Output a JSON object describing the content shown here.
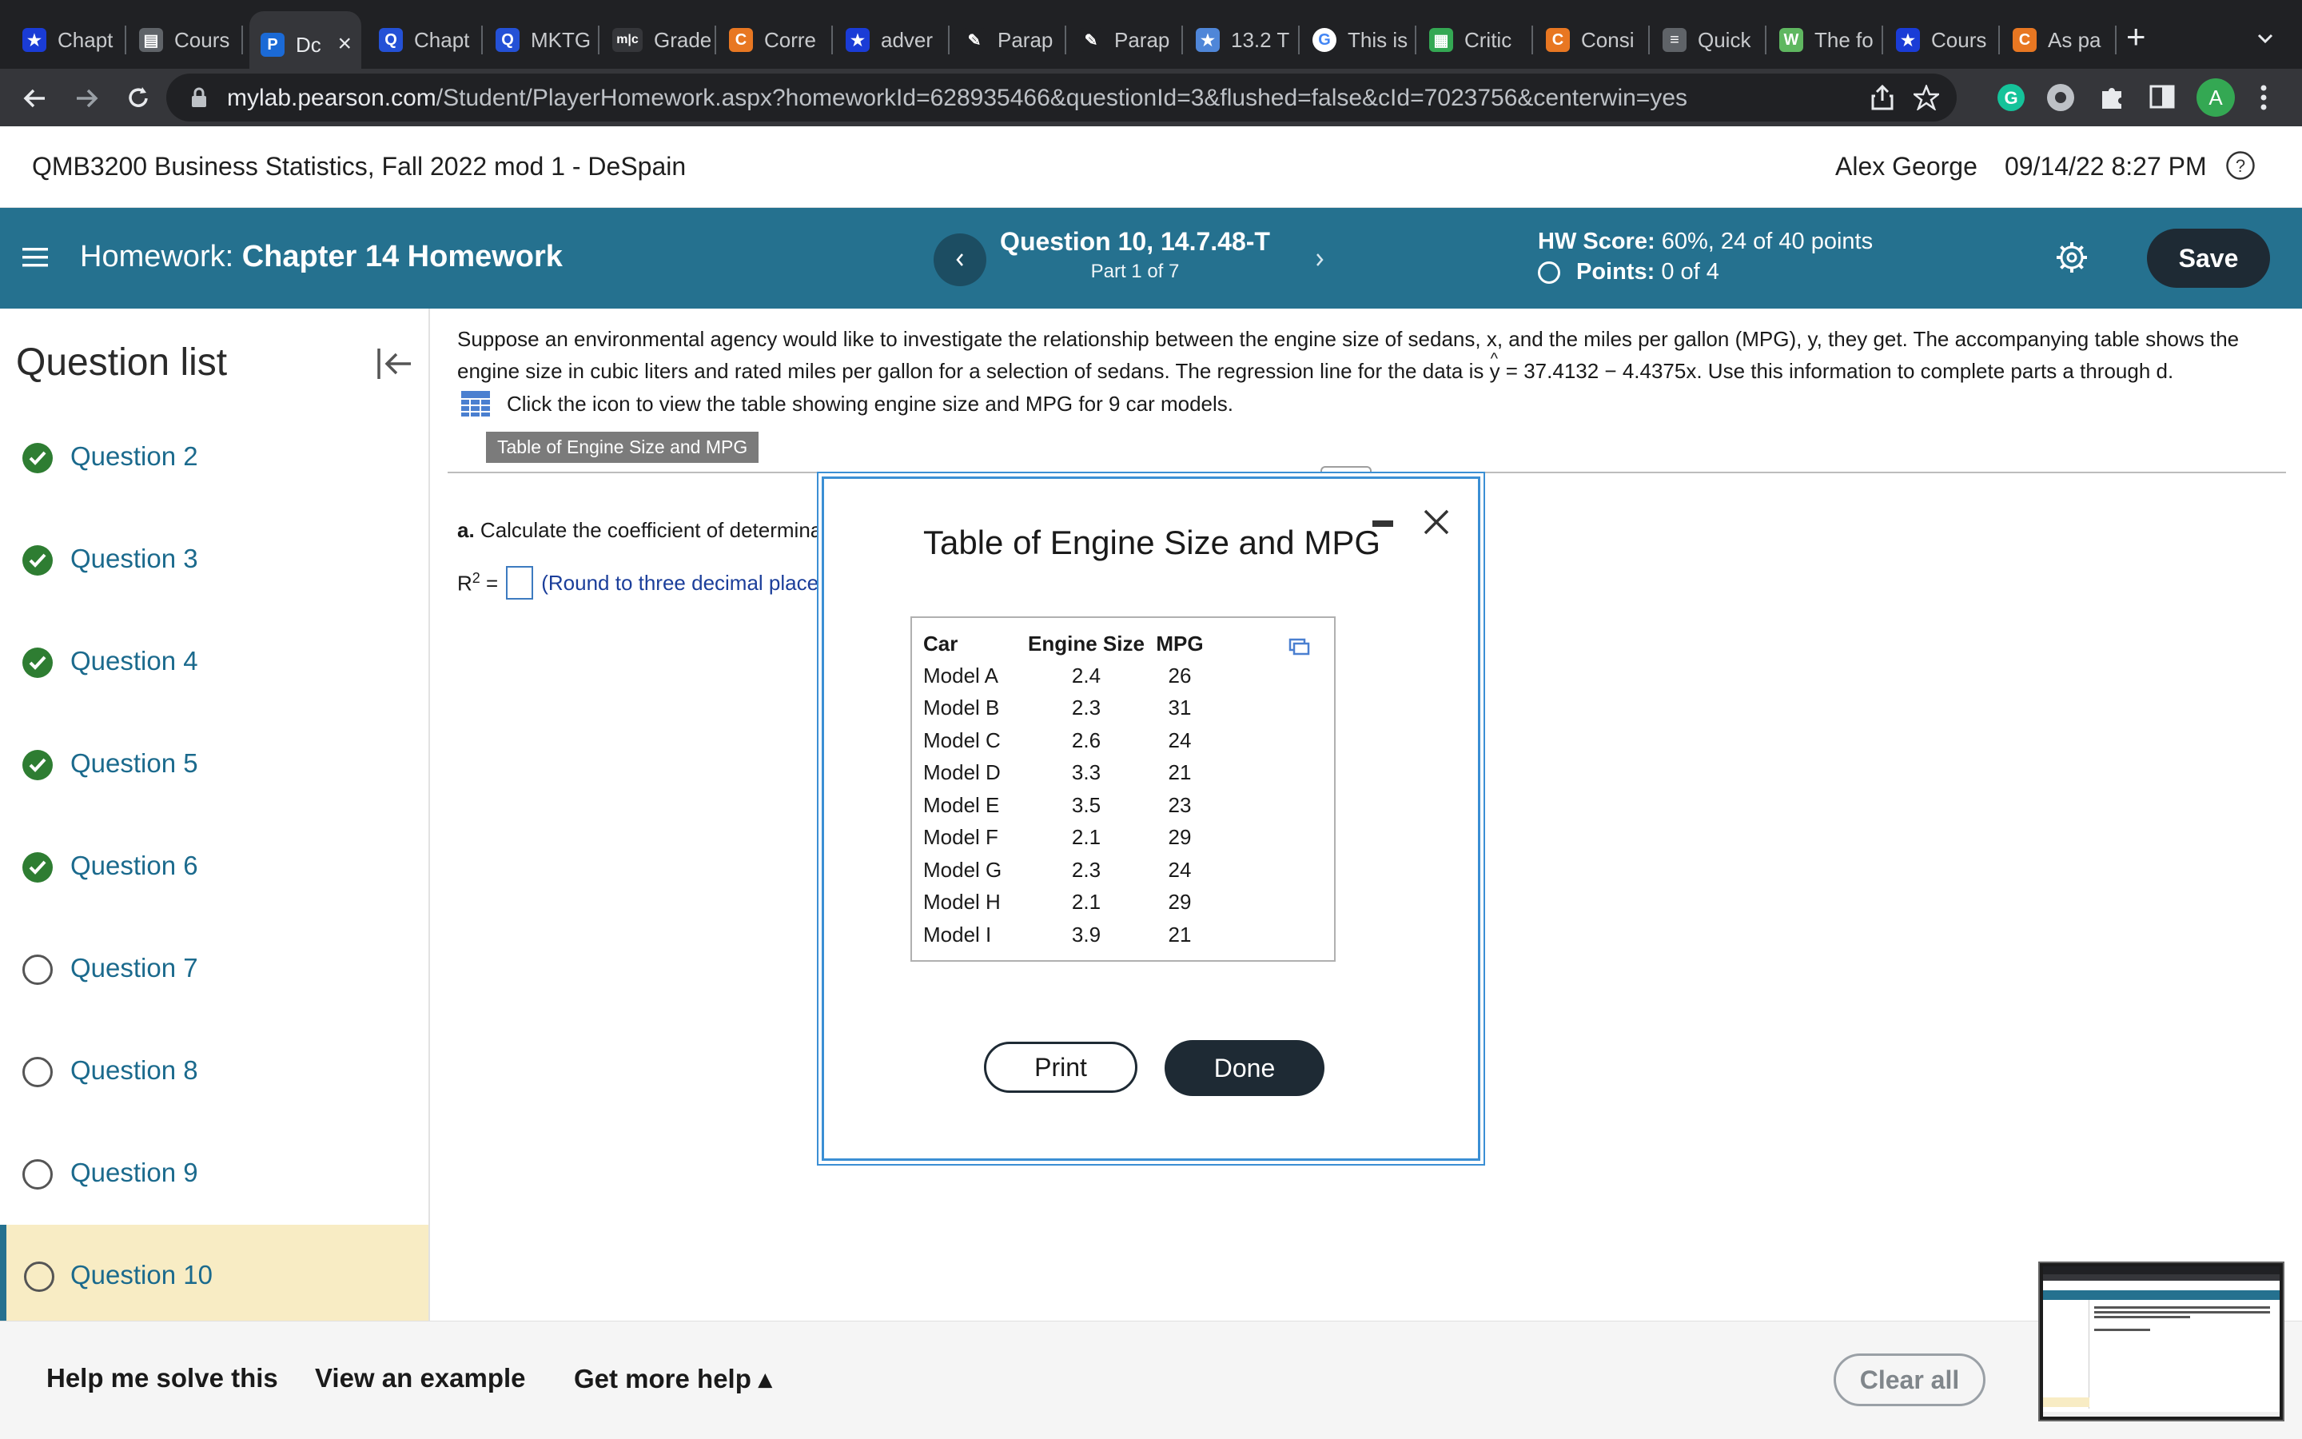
{
  "browser": {
    "tabs": [
      {
        "label": "Chapt",
        "icon": "star-icon",
        "color": "#1a3cd6"
      },
      {
        "label": "Cours",
        "icon": "document-icon",
        "color": "#5f6368"
      },
      {
        "label": "Dc",
        "icon": "pearson-icon",
        "color": "#1b6ad6",
        "active": true
      },
      {
        "label": "Chapt",
        "icon": "q-icon",
        "color": "#2451d6"
      },
      {
        "label": "MKTG",
        "icon": "q-icon",
        "color": "#2451d6"
      },
      {
        "label": "Grade",
        "icon": "mlc-icon",
        "color": "#35363a"
      },
      {
        "label": "Corre",
        "icon": "chegg-icon",
        "color": "#e87722"
      },
      {
        "label": "adver",
        "icon": "star-icon",
        "color": "#1a3cd6"
      },
      {
        "label": "Parap",
        "icon": "quill-icon",
        "color": "#202124"
      },
      {
        "label": "Parap",
        "icon": "quill-icon",
        "color": "#202124"
      },
      {
        "label": "13.2 T",
        "icon": "star-box-icon",
        "color": "#4f86d8"
      },
      {
        "label": "This is",
        "icon": "google-icon",
        "color": "#ffffff"
      },
      {
        "label": "Critic",
        "icon": "grid-icon",
        "color": "#34a853"
      },
      {
        "label": "Consi",
        "icon": "chegg-icon",
        "color": "#e87722"
      },
      {
        "label": "Quick",
        "icon": "bars-icon",
        "color": "#5f6368"
      },
      {
        "label": "The fo",
        "icon": "w-icon",
        "color": "#5fb760"
      },
      {
        "label": "Cours",
        "icon": "star-icon",
        "color": "#1a3cd6"
      },
      {
        "label": "As pa",
        "icon": "chegg-icon",
        "color": "#e87722"
      }
    ],
    "url_host": "mylab.pearson.com",
    "url_rest": "/Student/PlayerHomework.aspx?homeworkId=628935466&questionId=3&flushed=false&cId=7023756&centerwin=yes",
    "avatar_letter": "A"
  },
  "course": {
    "title": "QMB3200 Business Statistics, Fall 2022 mod 1 - DeSpain",
    "user": "Alex George",
    "datetime": "09/14/22 8:27 PM"
  },
  "homework": {
    "prefix": "Homework:",
    "name": "Chapter 14 Homework",
    "question_title": "Question 10, 14.7.48-T",
    "part": "Part 1 of 7",
    "score_label": "HW Score:",
    "score_value": "60%, 24 of 40 points",
    "points_label": "Points:",
    "points_value": "0 of 4",
    "save_label": "Save"
  },
  "sidebar": {
    "title": "Question list",
    "items": [
      {
        "label": "Question 2",
        "status": "done"
      },
      {
        "label": "Question 3",
        "status": "done"
      },
      {
        "label": "Question 4",
        "status": "done"
      },
      {
        "label": "Question 5",
        "status": "done"
      },
      {
        "label": "Question 6",
        "status": "done"
      },
      {
        "label": "Question 7",
        "status": "open"
      },
      {
        "label": "Question 8",
        "status": "open"
      },
      {
        "label": "Question 9",
        "status": "open"
      },
      {
        "label": "Question 10",
        "status": "open",
        "current": true
      }
    ]
  },
  "question": {
    "text_1": "Suppose an environmental agency would like to investigate the relationship between the engine size of sedans, x, and the miles per gallon (MPG), y, they get. The accompanying table shows the engine size in cubic liters and rated miles per gallon for a selection of sedans. The regression line for the data is ",
    "y_hat": "y",
    "text_2": " = 37.4132 − 4.4375x. Use this information to complete parts a through d.",
    "table_link": "Click the icon to view the table showing engine size and MPG for 9 car models.",
    "table_tag": "Table of Engine Size and MPG",
    "part_a_label": "a.",
    "part_a_text": "Calculate the coefficient of determina",
    "r2_label": "R",
    "r2_sup": "2",
    "r2_eq": "=",
    "r2_hint": "(Round to three decimal places"
  },
  "modal": {
    "title": "Table of Engine Size and MPG",
    "headers": [
      "Car",
      "Engine Size",
      "MPG"
    ],
    "rows": [
      [
        "Model A",
        "2.4",
        "26"
      ],
      [
        "Model B",
        "2.3",
        "31"
      ],
      [
        "Model C",
        "2.6",
        "24"
      ],
      [
        "Model D",
        "3.3",
        "21"
      ],
      [
        "Model E",
        "3.5",
        "23"
      ],
      [
        "Model F",
        "2.1",
        "29"
      ],
      [
        "Model G",
        "2.3",
        "24"
      ],
      [
        "Model H",
        "2.1",
        "29"
      ],
      [
        "Model I",
        "3.9",
        "21"
      ]
    ],
    "print_label": "Print",
    "done_label": "Done"
  },
  "footer": {
    "help_label": "Help me solve this",
    "example_label": "View an example",
    "more_help_label": "Get more help ▴",
    "clear_label": "Clear all"
  },
  "colors": {
    "header_bar": "#25718f",
    "link_blue": "#1b6a8d",
    "done_green": "#2e7d32",
    "current_highlight": "#f8ecc4",
    "dark_button": "#1e2a34"
  }
}
